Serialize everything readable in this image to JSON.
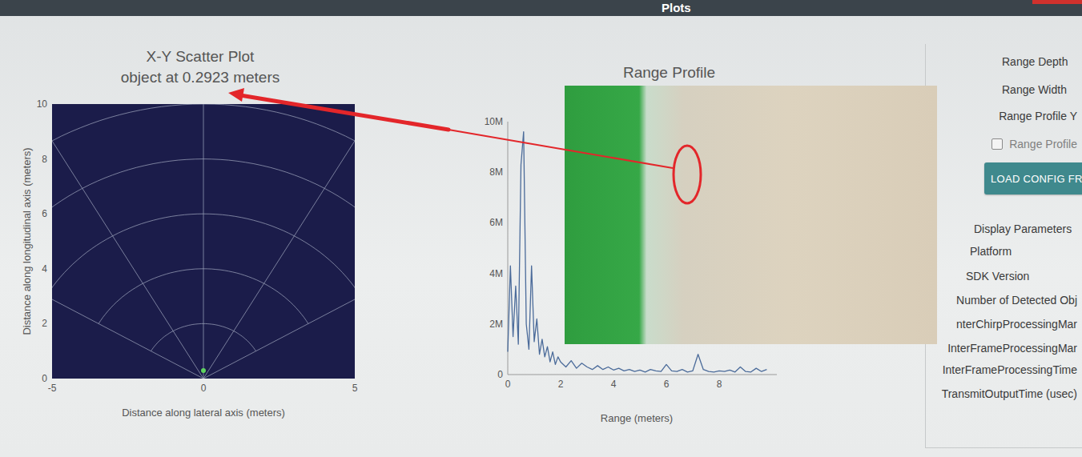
{
  "window": {
    "title": "Plots"
  },
  "scatter": {
    "title": "X-Y Scatter Plot",
    "subtitle": "object at 0.2923 meters",
    "y_label": "Distance along longitudinal axis (meters)",
    "x_label": "Distance along lateral axis (meters)",
    "y_ticks": [
      "0",
      "2",
      "4",
      "6",
      "8",
      "10"
    ],
    "x_ticks": [
      "-5",
      "0",
      "5"
    ],
    "points": [
      {
        "x": 0,
        "y": 0.2923
      }
    ]
  },
  "range_profile": {
    "title": "Range Profile",
    "y_ticks": [
      "0",
      "2M",
      "4M",
      "6M",
      "8M",
      "10M"
    ],
    "x_ticks": [
      "0",
      "2",
      "4",
      "6",
      "8"
    ],
    "x_label": "Range (meters)",
    "series": [
      {
        "range": [
          0,
          0.1,
          0.2,
          0.3,
          0.4,
          0.5,
          0.6,
          0.7,
          0.8,
          0.9,
          1,
          1.1,
          1.2,
          1.3,
          1.4,
          1.5,
          1.6,
          1.7,
          1.8,
          1.9,
          2,
          2.2,
          2.4,
          2.6,
          2.8,
          3,
          3.2,
          3.4,
          3.6,
          3.8,
          4,
          4.2,
          4.4,
          4.6,
          4.8,
          5,
          5.2,
          5.4,
          5.6,
          5.8,
          6,
          6.2,
          6.4,
          6.6,
          6.8,
          7,
          7.2,
          7.4,
          7.6,
          7.8,
          8,
          8.2,
          8.4,
          8.6,
          8.8,
          9,
          9.2,
          9.4,
          9.6,
          9.8
        ],
        "values": [
          900000,
          4300000,
          1500000,
          3500000,
          1200000,
          8300000,
          9600000,
          2000000,
          1000000,
          4300000,
          1300000,
          2200000,
          800000,
          1400000,
          700000,
          1100000,
          500000,
          900000,
          400000,
          700000,
          500000,
          300000,
          550000,
          250000,
          450000,
          300000,
          200000,
          350000,
          200000,
          300000,
          180000,
          250000,
          150000,
          200000,
          120000,
          180000,
          100000,
          200000,
          150000,
          120000,
          400000,
          150000,
          120000,
          200000,
          100000,
          150000,
          800000,
          200000,
          120000,
          100000,
          150000,
          120000,
          180000,
          100000,
          300000,
          120000,
          100000,
          250000,
          120000,
          200000
        ]
      }
    ]
  },
  "settings": {
    "items": [
      {
        "label": "Range Depth",
        "kind": "label",
        "disabled": false
      },
      {
        "label": "Range Width",
        "kind": "label",
        "disabled": false
      },
      {
        "label": "Range Profile Y",
        "kind": "label",
        "disabled": false
      },
      {
        "label": "Range Profile",
        "kind": "checkbox",
        "checked": false,
        "disabled": true
      },
      {
        "label": "LOAD CONFIG FR",
        "kind": "button",
        "disabled": false
      },
      {
        "label": "Display Parameters",
        "kind": "label",
        "disabled": false
      },
      {
        "label": "Platform",
        "kind": "label",
        "disabled": false
      },
      {
        "label": "SDK Version",
        "kind": "label",
        "disabled": false
      },
      {
        "label": "Number of Detected Obj",
        "kind": "label",
        "disabled": false
      },
      {
        "label": "nterChirpProcessingMar",
        "kind": "label",
        "disabled": false
      },
      {
        "label": "InterFrameProcessingMar",
        "kind": "label",
        "disabled": false
      },
      {
        "label": "InterFrameProcessingTime",
        "kind": "label",
        "disabled": false
      },
      {
        "label": "TransmitOutputTime (usec)",
        "kind": "label",
        "disabled": false
      }
    ]
  }
}
